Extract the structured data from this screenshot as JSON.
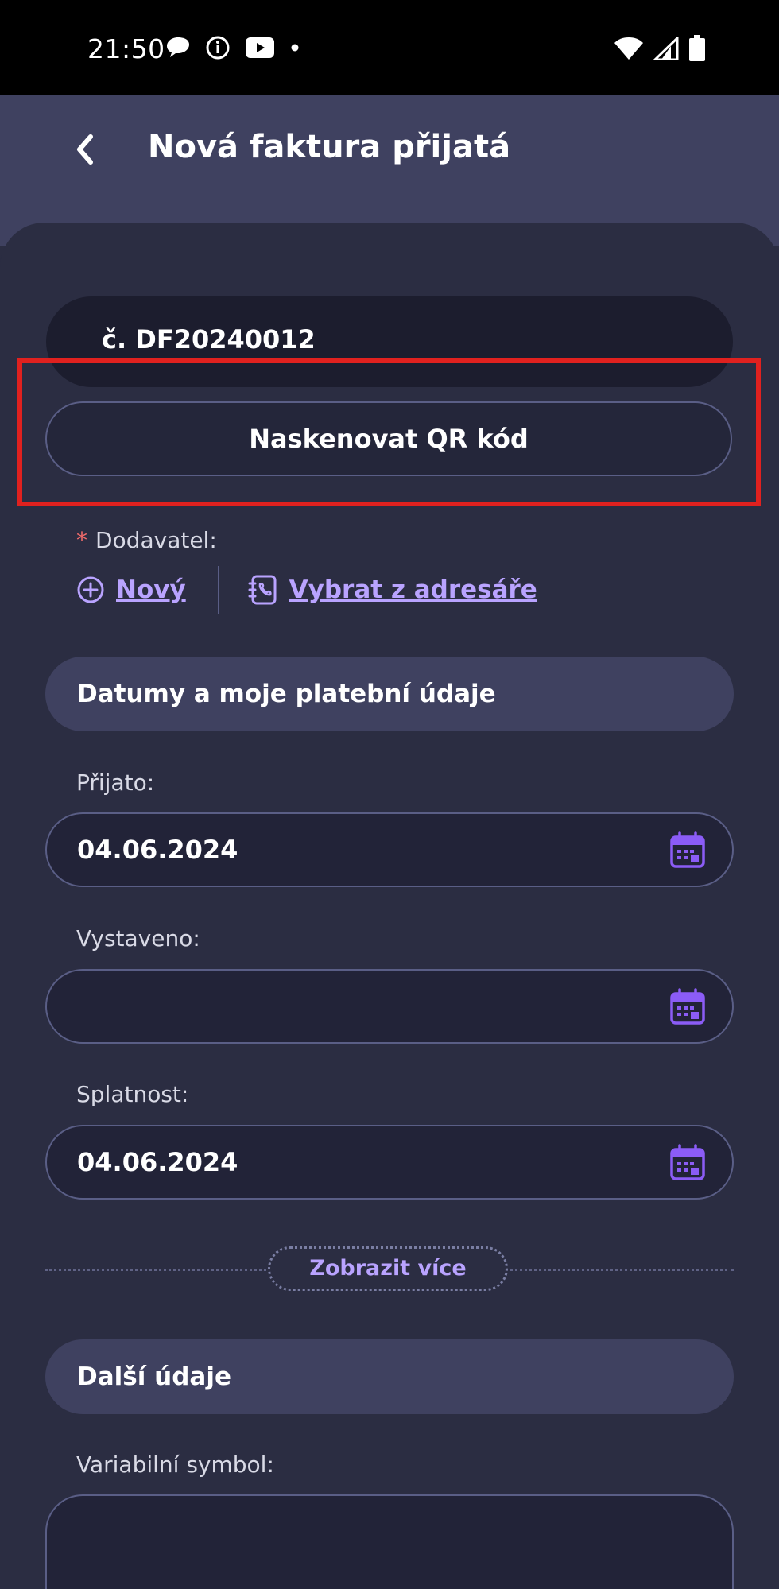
{
  "status_bar": {
    "time": "21:50",
    "left_icons": [
      "chat-bubble-icon",
      "info-icon",
      "youtube-icon",
      "dot-icon"
    ],
    "right_icons": [
      "wifi-icon",
      "cellular-signal-icon",
      "battery-icon"
    ]
  },
  "app_bar": {
    "back_icon": "chevron-left-icon",
    "title": "Nová faktura přijatá"
  },
  "form": {
    "document_number": "č. DF20240012",
    "scan_qr_label": "Naskenovat QR kód",
    "supplier": {
      "required_mark": "*",
      "label": "Dodavatel:",
      "new_label": "Nový",
      "new_icon": "plus-circle-icon",
      "address_book_label": "Vybrat z adresáře",
      "address_book_icon": "address-book-icon"
    },
    "dates_section": {
      "title": "Datumy a moje platební údaje",
      "received_label": "Přijato:",
      "received_value": "04.06.2024",
      "issued_label": "Vystaveno:",
      "issued_value": "",
      "due_label": "Splatnost:",
      "due_value": "04.06.2024",
      "calendar_icon": "calendar-icon"
    },
    "show_more_label": "Zobrazit více",
    "other_section": {
      "title": "Další údaje",
      "variable_symbol_label": "Variabilní symbol:",
      "variable_symbol_value": ""
    }
  },
  "colors": {
    "accent": "#b9a3ff",
    "calendar_icon": "#8b5cf6",
    "highlight": "#e0211f",
    "app_bar": "#3f4160",
    "background": "#2b2d42"
  }
}
